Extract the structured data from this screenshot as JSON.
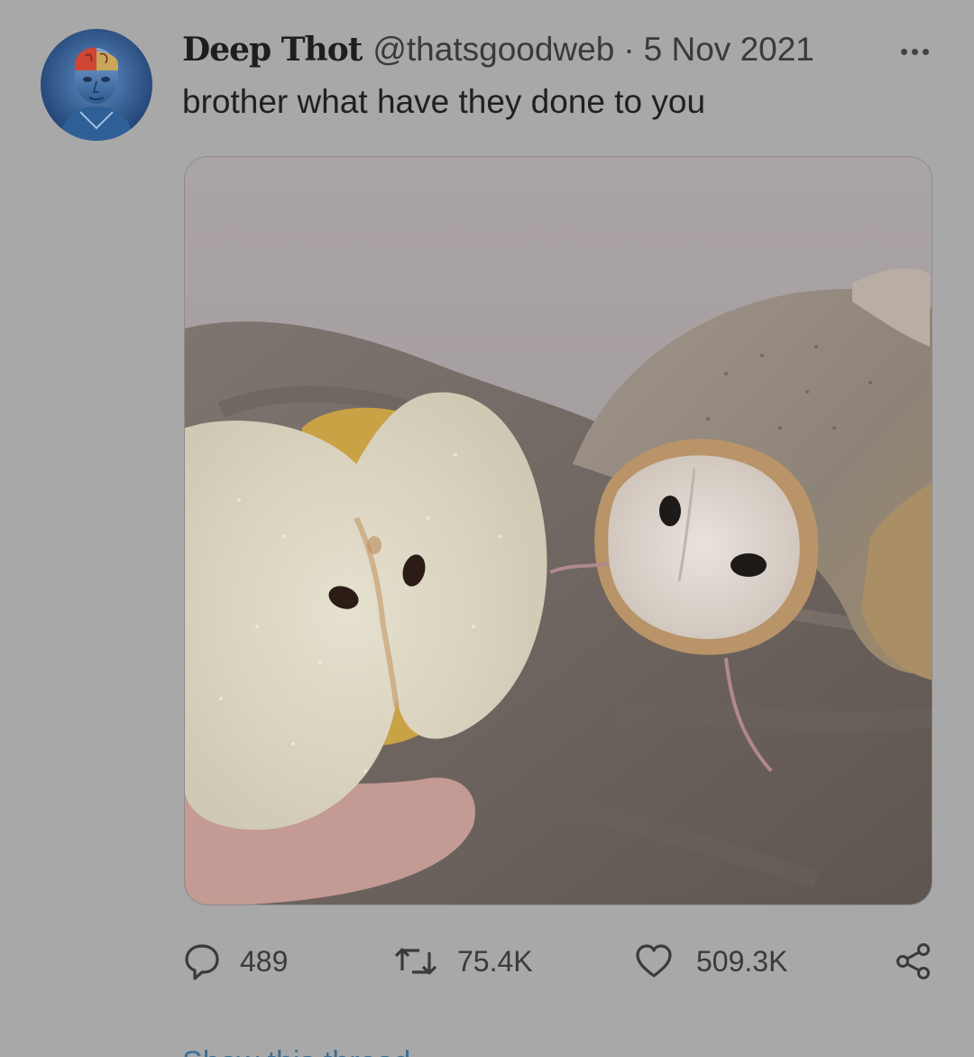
{
  "tweet": {
    "display_name": "Deep Thot",
    "handle": "@thatsgoodweb",
    "separator": "·",
    "date": "5 Nov 2021",
    "text": "brother what have they done to you"
  },
  "icons": {
    "avatar": "anatomical-head-avatar",
    "more": "more-horizontal-icon",
    "reply": "reply-bubble-icon",
    "retweet": "retweet-icon",
    "like": "heart-icon",
    "share": "share-icon"
  },
  "actions": {
    "replies": "489",
    "retweets": "75.4K",
    "likes": "509.3K"
  },
  "footer": {
    "show_thread": "Show this thread"
  },
  "colors": {
    "background": "#a8a8a8",
    "link": "#3d6f93",
    "text": "#202020"
  }
}
